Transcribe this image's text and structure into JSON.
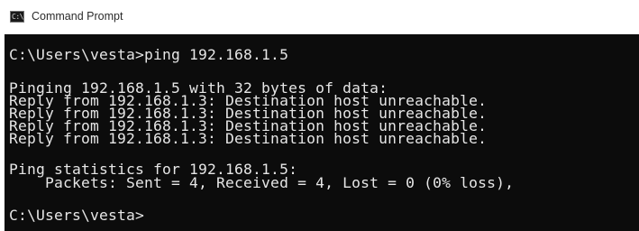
{
  "window": {
    "title": "Command Prompt",
    "icon": "cmd-terminal-icon",
    "icon_glyph": "C:\\"
  },
  "console": {
    "background": "#0c0c0c",
    "text_color": "#e6e6e6",
    "lines": [
      "C:\\Users\\vesta>ping 192.168.1.5",
      "Pinging 192.168.1.5 with 32 bytes of data:",
      "Reply from 192.168.1.3: Destination host unreachable.",
      "Reply from 192.168.1.3: Destination host unreachable.",
      "Reply from 192.168.1.3: Destination host unreachable.",
      "Reply from 192.168.1.3: Destination host unreachable.",
      "Ping statistics for 192.168.1.5:",
      "    Packets: Sent = 4, Received = 4, Lost = 0 (0% loss),",
      "C:\\Users\\vesta>"
    ]
  }
}
